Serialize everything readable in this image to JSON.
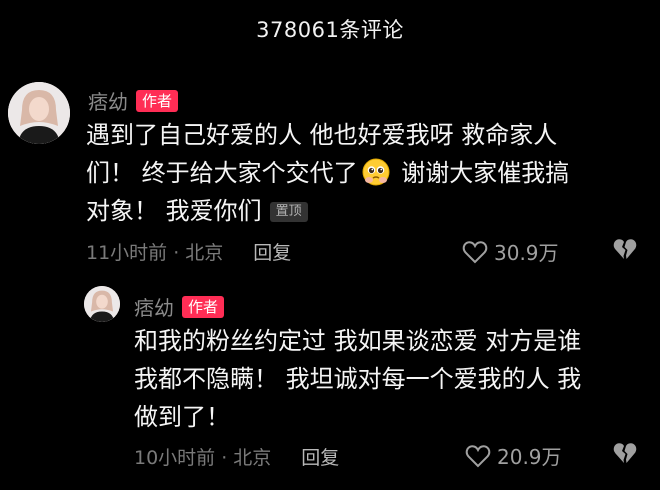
{
  "header": {
    "title": "378061条评论"
  },
  "comments": [
    {
      "username": "痞幼",
      "badge": "作者",
      "text_line1": "遇到了自己好爱的人 他也好爱我呀 救命家人",
      "text_line2a": "们！ 终于给大家个交代了",
      "emoji": "pleading-face-emoji",
      "text_line2b": " 谢谢大家催我搞",
      "text_line3": "对象！ 我爱你们",
      "pin": "置顶",
      "time_location": "11小时前 · 北京",
      "reply_label": "回复",
      "likes": "30.9万"
    },
    {
      "username": "痞幼",
      "badge": "作者",
      "text_line1": "和我的粉丝约定过 我如果谈恋爱 对方是谁",
      "text_line2": "我都不隐瞒！ 我坦诚对每一个爱我的人 我",
      "text_line3": "做到了！",
      "time_location": "10小时前 · 北京",
      "reply_label": "回复",
      "likes": "20.9万"
    }
  ],
  "icons": {
    "like": "heart-outline-icon",
    "dislike": "broken-heart-icon"
  },
  "colors": {
    "background": "#000000",
    "author_badge": "#ff2d55",
    "text": "#f5f5f5",
    "muted": "#7a7a7a"
  }
}
